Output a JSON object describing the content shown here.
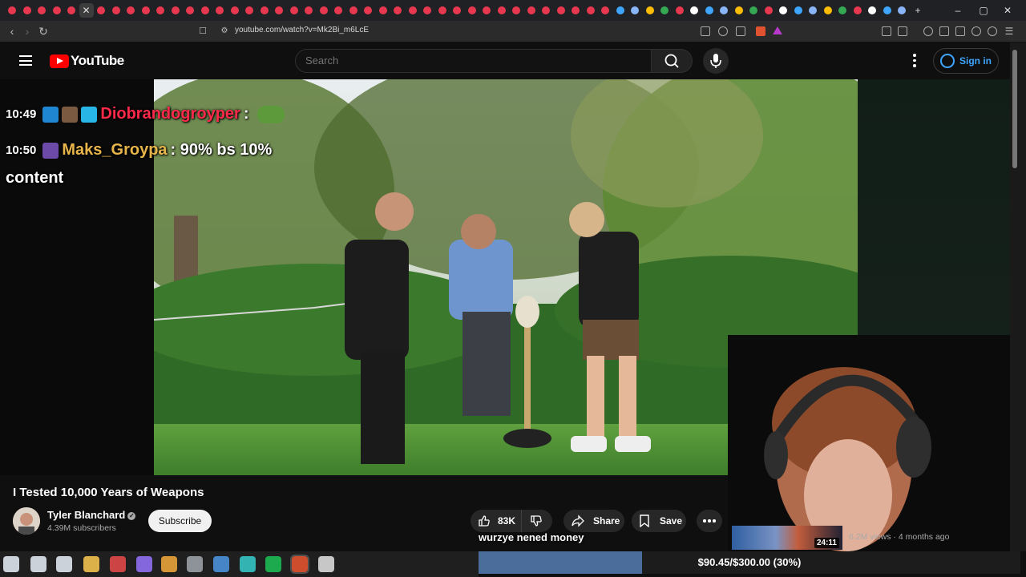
{
  "browser": {
    "url": "youtube.com/watch?v=Mk2Bi_m6LcE",
    "window_controls": {
      "minimize": "–",
      "maximize": "▢",
      "close": "✕"
    },
    "new_tab": "+"
  },
  "youtube": {
    "logo_text": "YouTube",
    "search_placeholder": "Search",
    "sign_in": "Sign in"
  },
  "stream_chat": [
    {
      "time": "10:49",
      "user": "Diobrandogroyper",
      "message": ":",
      "user_color": "#ff2a4a"
    },
    {
      "time": "10:50",
      "user": "Maks_Groypa",
      "message": ": 90% bs 10%",
      "continuation": "content",
      "user_color": "#e8b54a"
    }
  ],
  "video": {
    "title": "I Tested 10,000 Years of Weapons",
    "channel": "Tyler Blanchard",
    "subscribers": "4.39M subscribers",
    "subscribe_label": "Subscribe",
    "likes": "83K",
    "share_label": "Share",
    "save_label": "Save"
  },
  "suggestion": {
    "duration": "24:11",
    "meta": "6.2M views · 4 months ago"
  },
  "donation": {
    "message": "wurzye nened money",
    "goal_text": "$90.45/$300.00 (30%)",
    "progress": 0.3015
  },
  "colors": {
    "youtube_red": "#ff0000",
    "link_blue": "#3ea6ff",
    "goal_fill": "#4a6d9c"
  }
}
